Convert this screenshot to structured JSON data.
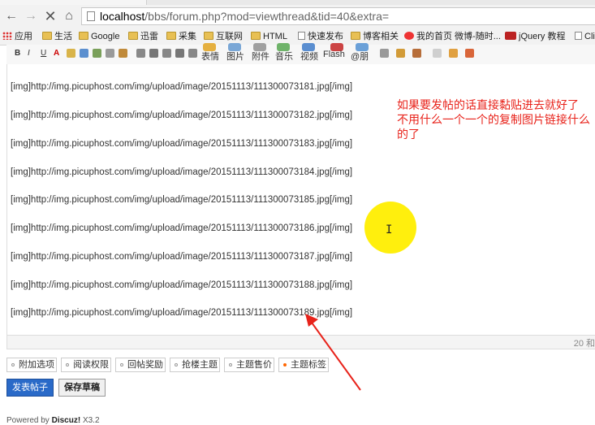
{
  "browser": {
    "url_host": "localhost",
    "url_rest": "/bbs/forum.php?mod=viewthread&tid=40&extra=",
    "bookmarks": [
      {
        "label": "应用",
        "icon": "apps-icon"
      },
      {
        "label": "生活",
        "icon": "folder-icon"
      },
      {
        "label": "Google",
        "icon": "folder-icon"
      },
      {
        "label": "迅雷",
        "icon": "folder-icon"
      },
      {
        "label": "采集",
        "icon": "folder-icon"
      },
      {
        "label": "互联网",
        "icon": "folder-icon"
      },
      {
        "label": "HTML",
        "icon": "folder-icon"
      },
      {
        "label": "快速发布",
        "icon": "page-icon"
      },
      {
        "label": "博客相关",
        "icon": "folder-icon"
      },
      {
        "label": "我的首页 微博-随时...",
        "icon": "weibo-icon"
      },
      {
        "label": "jQuery 教程",
        "icon": "w3-icon"
      },
      {
        "label": "Cli",
        "icon": "page-icon"
      }
    ]
  },
  "toolbar": {
    "format_buttons": [
      "B",
      "I",
      "U",
      "A"
    ],
    "labeled_buttons": [
      "表情",
      "图片",
      "附件",
      "音乐",
      "视频",
      "Flash",
      "@朋"
    ]
  },
  "editor": {
    "lines": [
      "[img]http://img.picuphost.com/img/upload/image/20151113/111300073181.jpg[/img]",
      "[img]http://img.picuphost.com/img/upload/image/20151113/111300073182.jpg[/img]",
      "[img]http://img.picuphost.com/img/upload/image/20151113/111300073183.jpg[/img]",
      "[img]http://img.picuphost.com/img/upload/image/20151113/111300073184.jpg[/img]",
      "[img]http://img.picuphost.com/img/upload/image/20151113/111300073185.jpg[/img]",
      "[img]http://img.picuphost.com/img/upload/image/20151113/111300073186.jpg[/img]",
      "[img]http://img.picuphost.com/img/upload/image/20151113/111300073187.jpg[/img]",
      "[img]http://img.picuphost.com/img/upload/image/20151113/111300073188.jpg[/img]",
      "[img]http://img.picuphost.com/img/upload/image/20151113/111300073189.jpg[/img]"
    ],
    "note_line1": "如果要发帖的话直接黏贴进去就好了",
    "note_line2": "不用什么一个一个的复制图片链接什么的了",
    "word_count": "20 和"
  },
  "options": [
    "附加选项",
    "阅读权限",
    "回帖奖励",
    "抢楼主题",
    "主题售价",
    "主题标签"
  ],
  "buttons": {
    "submit": "发表帖子",
    "draft": "保存草稿"
  },
  "footer": {
    "powered_prefix": "Powered by",
    "brand": "Discuz!",
    "version": "X3.2"
  },
  "colors": {
    "annotation": "#e8231b",
    "highlight": "#ffee00",
    "submit": "#2a6ac8"
  }
}
